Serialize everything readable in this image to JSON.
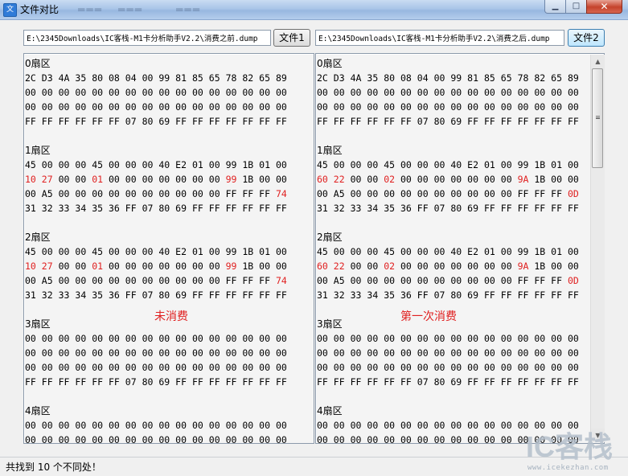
{
  "window": {
    "title": "文件对比"
  },
  "files": {
    "left": {
      "path": "E:\\2345Downloads\\IC客栈-M1卡分析助手V2.2\\消费之前.dump",
      "button": "文件1"
    },
    "right": {
      "path": "E:\\2345Downloads\\IC客栈-M1卡分析助手V2.2\\消费之后.dump",
      "button": "文件2"
    }
  },
  "left_pane": {
    "annotation": "未消费",
    "lines": [
      {
        "kind": "section",
        "text": "0扇区"
      },
      {
        "kind": "hex",
        "cells": [
          "2C",
          "D3",
          "4A",
          "35",
          "80",
          "08",
          "04",
          "00",
          "99",
          "81",
          "85",
          "65",
          "78",
          "82",
          "65",
          "89"
        ]
      },
      {
        "kind": "hex",
        "cells": [
          "00",
          "00",
          "00",
          "00",
          "00",
          "00",
          "00",
          "00",
          "00",
          "00",
          "00",
          "00",
          "00",
          "00",
          "00",
          "00"
        ]
      },
      {
        "kind": "hex",
        "cells": [
          "00",
          "00",
          "00",
          "00",
          "00",
          "00",
          "00",
          "00",
          "00",
          "00",
          "00",
          "00",
          "00",
          "00",
          "00",
          "00"
        ]
      },
      {
        "kind": "hex",
        "cells": [
          "FF",
          "FF",
          "FF",
          "FF",
          "FF",
          "FF",
          "07",
          "80",
          "69",
          "FF",
          "FF",
          "FF",
          "FF",
          "FF",
          "FF",
          "FF"
        ]
      },
      {
        "kind": "blank"
      },
      {
        "kind": "section",
        "text": "1扇区"
      },
      {
        "kind": "hex",
        "cells": [
          "45",
          "00",
          "00",
          "00",
          "45",
          "00",
          "00",
          "00",
          "40",
          "E2",
          "01",
          "00",
          "99",
          "1B",
          "01",
          "00"
        ]
      },
      {
        "kind": "hex",
        "cells": [
          "10",
          "27",
          "00",
          "00",
          "01",
          "00",
          "00",
          "00",
          "00",
          "00",
          "00",
          "00",
          "99",
          "1B",
          "00",
          "00"
        ],
        "diff": [
          0,
          1,
          4,
          12
        ]
      },
      {
        "kind": "hex",
        "cells": [
          "00",
          "A5",
          "00",
          "00",
          "00",
          "00",
          "00",
          "00",
          "00",
          "00",
          "00",
          "00",
          "FF",
          "FF",
          "FF",
          "74"
        ],
        "diff": [
          15
        ]
      },
      {
        "kind": "hex",
        "cells": [
          "31",
          "32",
          "33",
          "34",
          "35",
          "36",
          "FF",
          "07",
          "80",
          "69",
          "FF",
          "FF",
          "FF",
          "FF",
          "FF",
          "FF"
        ]
      },
      {
        "kind": "blank"
      },
      {
        "kind": "section",
        "text": "2扇区"
      },
      {
        "kind": "hex",
        "cells": [
          "45",
          "00",
          "00",
          "00",
          "45",
          "00",
          "00",
          "00",
          "40",
          "E2",
          "01",
          "00",
          "99",
          "1B",
          "01",
          "00"
        ]
      },
      {
        "kind": "hex",
        "cells": [
          "10",
          "27",
          "00",
          "00",
          "01",
          "00",
          "00",
          "00",
          "00",
          "00",
          "00",
          "00",
          "99",
          "1B",
          "00",
          "00"
        ],
        "diff": [
          0,
          1,
          4,
          12
        ]
      },
      {
        "kind": "hex",
        "cells": [
          "00",
          "A5",
          "00",
          "00",
          "00",
          "00",
          "00",
          "00",
          "00",
          "00",
          "00",
          "00",
          "FF",
          "FF",
          "FF",
          "74"
        ],
        "diff": [
          15
        ]
      },
      {
        "kind": "hex",
        "cells": [
          "31",
          "32",
          "33",
          "34",
          "35",
          "36",
          "FF",
          "07",
          "80",
          "69",
          "FF",
          "FF",
          "FF",
          "FF",
          "FF",
          "FF"
        ]
      },
      {
        "kind": "blank"
      },
      {
        "kind": "section",
        "text": "3扇区"
      },
      {
        "kind": "hex",
        "cells": [
          "00",
          "00",
          "00",
          "00",
          "00",
          "00",
          "00",
          "00",
          "00",
          "00",
          "00",
          "00",
          "00",
          "00",
          "00",
          "00"
        ]
      },
      {
        "kind": "hex",
        "cells": [
          "00",
          "00",
          "00",
          "00",
          "00",
          "00",
          "00",
          "00",
          "00",
          "00",
          "00",
          "00",
          "00",
          "00",
          "00",
          "00"
        ]
      },
      {
        "kind": "hex",
        "cells": [
          "00",
          "00",
          "00",
          "00",
          "00",
          "00",
          "00",
          "00",
          "00",
          "00",
          "00",
          "00",
          "00",
          "00",
          "00",
          "00"
        ]
      },
      {
        "kind": "hex",
        "cells": [
          "FF",
          "FF",
          "FF",
          "FF",
          "FF",
          "FF",
          "07",
          "80",
          "69",
          "FF",
          "FF",
          "FF",
          "FF",
          "FF",
          "FF",
          "FF"
        ]
      },
      {
        "kind": "blank"
      },
      {
        "kind": "section",
        "text": "4扇区"
      },
      {
        "kind": "hex",
        "cells": [
          "00",
          "00",
          "00",
          "00",
          "00",
          "00",
          "00",
          "00",
          "00",
          "00",
          "00",
          "00",
          "00",
          "00",
          "00",
          "00"
        ]
      },
      {
        "kind": "hex",
        "cells": [
          "00",
          "00",
          "00",
          "00",
          "00",
          "00",
          "00",
          "00",
          "00",
          "00",
          "00",
          "00",
          "00",
          "00",
          "00",
          "00"
        ]
      }
    ]
  },
  "right_pane": {
    "annotation": "第一次消费",
    "lines": [
      {
        "kind": "section",
        "text": "0扇区"
      },
      {
        "kind": "hex",
        "cells": [
          "2C",
          "D3",
          "4A",
          "35",
          "80",
          "08",
          "04",
          "00",
          "99",
          "81",
          "85",
          "65",
          "78",
          "82",
          "65",
          "89"
        ]
      },
      {
        "kind": "hex",
        "cells": [
          "00",
          "00",
          "00",
          "00",
          "00",
          "00",
          "00",
          "00",
          "00",
          "00",
          "00",
          "00",
          "00",
          "00",
          "00",
          "00"
        ]
      },
      {
        "kind": "hex",
        "cells": [
          "00",
          "00",
          "00",
          "00",
          "00",
          "00",
          "00",
          "00",
          "00",
          "00",
          "00",
          "00",
          "00",
          "00",
          "00",
          "00"
        ]
      },
      {
        "kind": "hex",
        "cells": [
          "FF",
          "FF",
          "FF",
          "FF",
          "FF",
          "FF",
          "07",
          "80",
          "69",
          "FF",
          "FF",
          "FF",
          "FF",
          "FF",
          "FF",
          "FF"
        ]
      },
      {
        "kind": "blank"
      },
      {
        "kind": "section",
        "text": "1扇区"
      },
      {
        "kind": "hex",
        "cells": [
          "45",
          "00",
          "00",
          "00",
          "45",
          "00",
          "00",
          "00",
          "40",
          "E2",
          "01",
          "00",
          "99",
          "1B",
          "01",
          "00"
        ]
      },
      {
        "kind": "hex",
        "cells": [
          "60",
          "22",
          "00",
          "00",
          "02",
          "00",
          "00",
          "00",
          "00",
          "00",
          "00",
          "00",
          "9A",
          "1B",
          "00",
          "00"
        ],
        "diff": [
          0,
          1,
          4,
          12
        ]
      },
      {
        "kind": "hex",
        "cells": [
          "00",
          "A5",
          "00",
          "00",
          "00",
          "00",
          "00",
          "00",
          "00",
          "00",
          "00",
          "00",
          "FF",
          "FF",
          "FF",
          "0D"
        ],
        "diff": [
          15
        ]
      },
      {
        "kind": "hex",
        "cells": [
          "31",
          "32",
          "33",
          "34",
          "35",
          "36",
          "FF",
          "07",
          "80",
          "69",
          "FF",
          "FF",
          "FF",
          "FF",
          "FF",
          "FF"
        ]
      },
      {
        "kind": "blank"
      },
      {
        "kind": "section",
        "text": "2扇区"
      },
      {
        "kind": "hex",
        "cells": [
          "45",
          "00",
          "00",
          "00",
          "45",
          "00",
          "00",
          "00",
          "40",
          "E2",
          "01",
          "00",
          "99",
          "1B",
          "01",
          "00"
        ]
      },
      {
        "kind": "hex",
        "cells": [
          "60",
          "22",
          "00",
          "00",
          "02",
          "00",
          "00",
          "00",
          "00",
          "00",
          "00",
          "00",
          "9A",
          "1B",
          "00",
          "00"
        ],
        "diff": [
          0,
          1,
          4,
          12
        ]
      },
      {
        "kind": "hex",
        "cells": [
          "00",
          "A5",
          "00",
          "00",
          "00",
          "00",
          "00",
          "00",
          "00",
          "00",
          "00",
          "00",
          "FF",
          "FF",
          "FF",
          "0D"
        ],
        "diff": [
          15
        ]
      },
      {
        "kind": "hex",
        "cells": [
          "31",
          "32",
          "33",
          "34",
          "35",
          "36",
          "FF",
          "07",
          "80",
          "69",
          "FF",
          "FF",
          "FF",
          "FF",
          "FF",
          "FF"
        ]
      },
      {
        "kind": "blank"
      },
      {
        "kind": "section",
        "text": "3扇区"
      },
      {
        "kind": "hex",
        "cells": [
          "00",
          "00",
          "00",
          "00",
          "00",
          "00",
          "00",
          "00",
          "00",
          "00",
          "00",
          "00",
          "00",
          "00",
          "00",
          "00"
        ]
      },
      {
        "kind": "hex",
        "cells": [
          "00",
          "00",
          "00",
          "00",
          "00",
          "00",
          "00",
          "00",
          "00",
          "00",
          "00",
          "00",
          "00",
          "00",
          "00",
          "00"
        ]
      },
      {
        "kind": "hex",
        "cells": [
          "00",
          "00",
          "00",
          "00",
          "00",
          "00",
          "00",
          "00",
          "00",
          "00",
          "00",
          "00",
          "00",
          "00",
          "00",
          "00"
        ]
      },
      {
        "kind": "hex",
        "cells": [
          "FF",
          "FF",
          "FF",
          "FF",
          "FF",
          "FF",
          "07",
          "80",
          "69",
          "FF",
          "FF",
          "FF",
          "FF",
          "FF",
          "FF",
          "FF"
        ]
      },
      {
        "kind": "blank"
      },
      {
        "kind": "section",
        "text": "4扇区"
      },
      {
        "kind": "hex",
        "cells": [
          "00",
          "00",
          "00",
          "00",
          "00",
          "00",
          "00",
          "00",
          "00",
          "00",
          "00",
          "00",
          "00",
          "00",
          "00",
          "00"
        ]
      },
      {
        "kind": "hex",
        "cells": [
          "00",
          "00",
          "00",
          "00",
          "00",
          "00",
          "00",
          "00",
          "00",
          "00",
          "00",
          "00",
          "00",
          "00",
          "00",
          "00"
        ]
      }
    ]
  },
  "status": {
    "text": "共找到 10 个不同处！"
  },
  "watermark": {
    "brand": "IC客栈",
    "url": "www.icekezhan.com"
  },
  "colors": {
    "diff": "#e02020",
    "title_bar": "#a9c5e8",
    "watermark": "#b5c0cc"
  }
}
